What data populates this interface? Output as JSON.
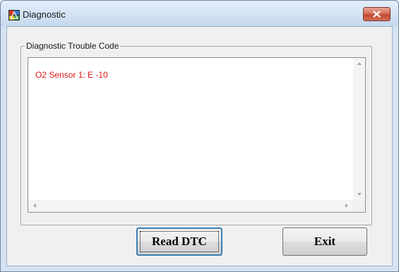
{
  "window": {
    "title": "Diagnostic",
    "icon": "app-icon",
    "close_icon": "close-icon"
  },
  "group": {
    "label": "Diagnostic Trouble Code"
  },
  "list": {
    "items": [
      "O2 Sensor 1: E -10"
    ],
    "text_color": "#e01818"
  },
  "buttons": {
    "read_label": "Read DTC",
    "exit_label": "Exit"
  },
  "colors": {
    "close_button": "#c24a35",
    "titlebar": "#d3e2f3",
    "focus_border": "#3c7fb1"
  }
}
